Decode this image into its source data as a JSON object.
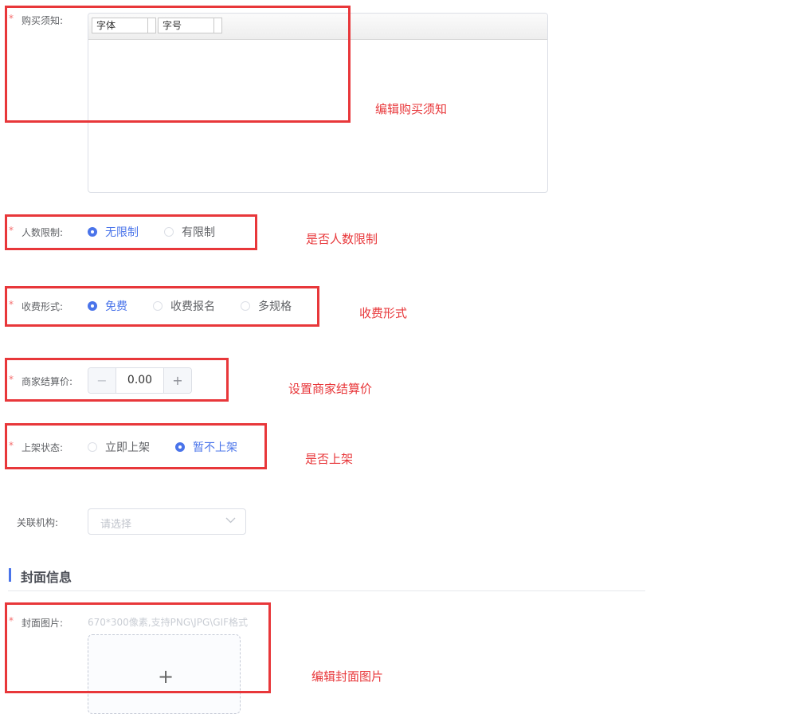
{
  "fields": {
    "purchase_notice": {
      "star": "*",
      "label": "购买须知:",
      "toolbar": {
        "font_label": "字体",
        "size_label": "字号"
      }
    },
    "people_limit": {
      "star": "*",
      "label": "人数限制:",
      "options": [
        {
          "label": "无限制",
          "checked": true
        },
        {
          "label": "有限制",
          "checked": false
        }
      ]
    },
    "charge_form": {
      "star": "*",
      "label": "收费形式:",
      "options": [
        {
          "label": "免费",
          "checked": true
        },
        {
          "label": "收费报名",
          "checked": false
        },
        {
          "label": "多规格",
          "checked": false
        }
      ]
    },
    "merchant_price": {
      "star": "*",
      "label": "商家结算价:",
      "minus": "−",
      "value": "0.00",
      "plus": "+"
    },
    "listing_status": {
      "star": "*",
      "label": "上架状态:",
      "options": [
        {
          "label": "立即上架",
          "checked": false
        },
        {
          "label": "暂不上架",
          "checked": true
        }
      ]
    },
    "related_org": {
      "label": "关联机构:",
      "placeholder": "请选择"
    }
  },
  "cover_section": {
    "title": "封面信息",
    "cover_image": {
      "star": "*",
      "label": "封面图片:",
      "hint": "670*300像素,支持PNG\\JPG\\GIF格式",
      "plus": "+"
    }
  },
  "annotations": {
    "purchase_notice": "编辑购买须知",
    "people_limit": "是否人数限制",
    "charge_form": "收费形式",
    "merchant_price": "设置商家结算价",
    "listing_status": "是否上架",
    "cover_image": "编辑封面图片"
  },
  "colors": {
    "accent": "#4a74ea",
    "required": "#f56c6c",
    "annotation": "#e8373a"
  },
  "icons": {
    "select_arrow": "chevron-down-icon"
  }
}
